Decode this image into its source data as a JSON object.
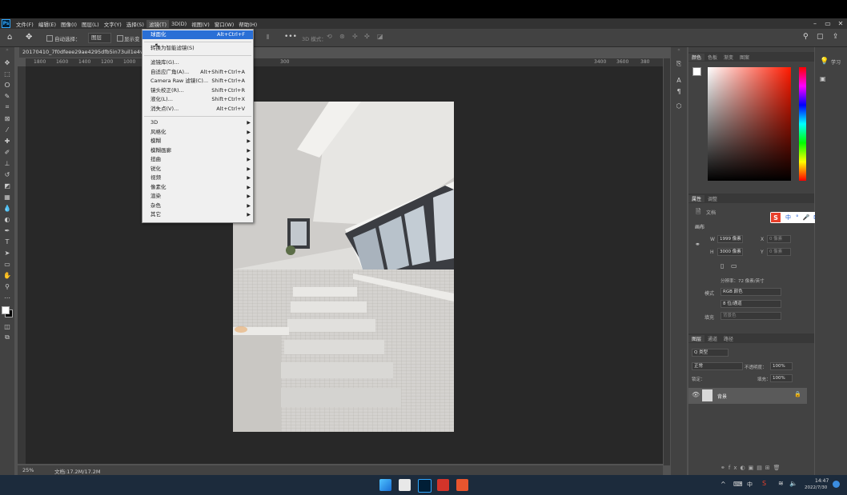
{
  "app": {
    "logo": "Ps"
  },
  "menubar": {
    "items": [
      "文件(F)",
      "编辑(E)",
      "图像(I)",
      "图层(L)",
      "文字(Y)",
      "选择(S)",
      "滤镜(T)",
      "3D(D)",
      "视图(V)",
      "窗口(W)",
      "帮助(H)"
    ],
    "active_index": 6
  },
  "options_bar": {
    "auto_select_label": "自动选择：",
    "layer_dropdown": "图层",
    "show_transform_label": "显示变",
    "mode_3d_label": "3D 模式："
  },
  "document": {
    "tab_title": "20170410_7f0dfeee29ae4295dfb5in73uil1e4v7_sp.p..."
  },
  "ruler": {
    "h_ticks": [
      "1800",
      "1600",
      "1400",
      "1200",
      "1000",
      "300",
      "3400",
      "3600",
      "380"
    ]
  },
  "statusbar": {
    "zoom": "25%",
    "doc_info": "文档:17.2M/17.2M"
  },
  "filter_menu": {
    "top_items": [
      {
        "label": "球面化",
        "shortcut": "Alt+Ctrl+F",
        "highlighted": true
      },
      {
        "label": "转换为智能滤镜(S)",
        "shortcut": ""
      }
    ],
    "mid_items": [
      {
        "label": "滤镜库(G)...",
        "shortcut": ""
      },
      {
        "label": "自适应广角(A)...",
        "shortcut": "Alt+Shift+Ctrl+A"
      },
      {
        "label": "Camera Raw 滤镜(C)...",
        "shortcut": "Shift+Ctrl+A"
      },
      {
        "label": "镜头校正(R)...",
        "shortcut": "Shift+Ctrl+R"
      },
      {
        "label": "液化(L)...",
        "shortcut": "Shift+Ctrl+X"
      },
      {
        "label": "消失点(V)...",
        "shortcut": "Alt+Ctrl+V"
      }
    ],
    "sub_items": [
      "3D",
      "风格化",
      "模糊",
      "模糊画廊",
      "扭曲",
      "锐化",
      "视频",
      "像素化",
      "渲染",
      "杂色",
      "其它"
    ]
  },
  "color_panel": {
    "tabs": [
      "颜色",
      "色板",
      "渐变",
      "图案"
    ]
  },
  "properties_panel": {
    "tabs": [
      "属性",
      "调整"
    ],
    "doc_label": "文档",
    "canvas_heading": "画布",
    "width_label": "W",
    "width_value": "1999 像素",
    "x_label": "X",
    "x_placeholder": "0 像素",
    "height_label": "H",
    "height_value": "3000 像素",
    "y_label": "Y",
    "y_placeholder": "0 像素",
    "resolution": "分辨率：72 像素/英寸",
    "mode_label": "模式",
    "mode_value": "RGB 颜色",
    "depth_value": "8 位/通道",
    "fill_label": "填充",
    "fill_value": "背景色"
  },
  "ime_toolbar": {
    "logo": "S",
    "label": "中"
  },
  "layers_panel": {
    "tabs": [
      "图层",
      "通道",
      "路径"
    ],
    "kind_label": "Q 类型",
    "blend_mode": "正常",
    "opacity_label": "不透明度：",
    "opacity_value": "100%",
    "lock_label": "锁定：",
    "fill_label": "填充：",
    "fill_value": "100%",
    "layers": [
      {
        "name": "背景",
        "visible": true,
        "locked": true
      }
    ]
  },
  "right_strip": {
    "learn_label": "学习"
  },
  "taskbar": {
    "ime": "中",
    "time": "14:47",
    "date": "2022/7/30"
  }
}
